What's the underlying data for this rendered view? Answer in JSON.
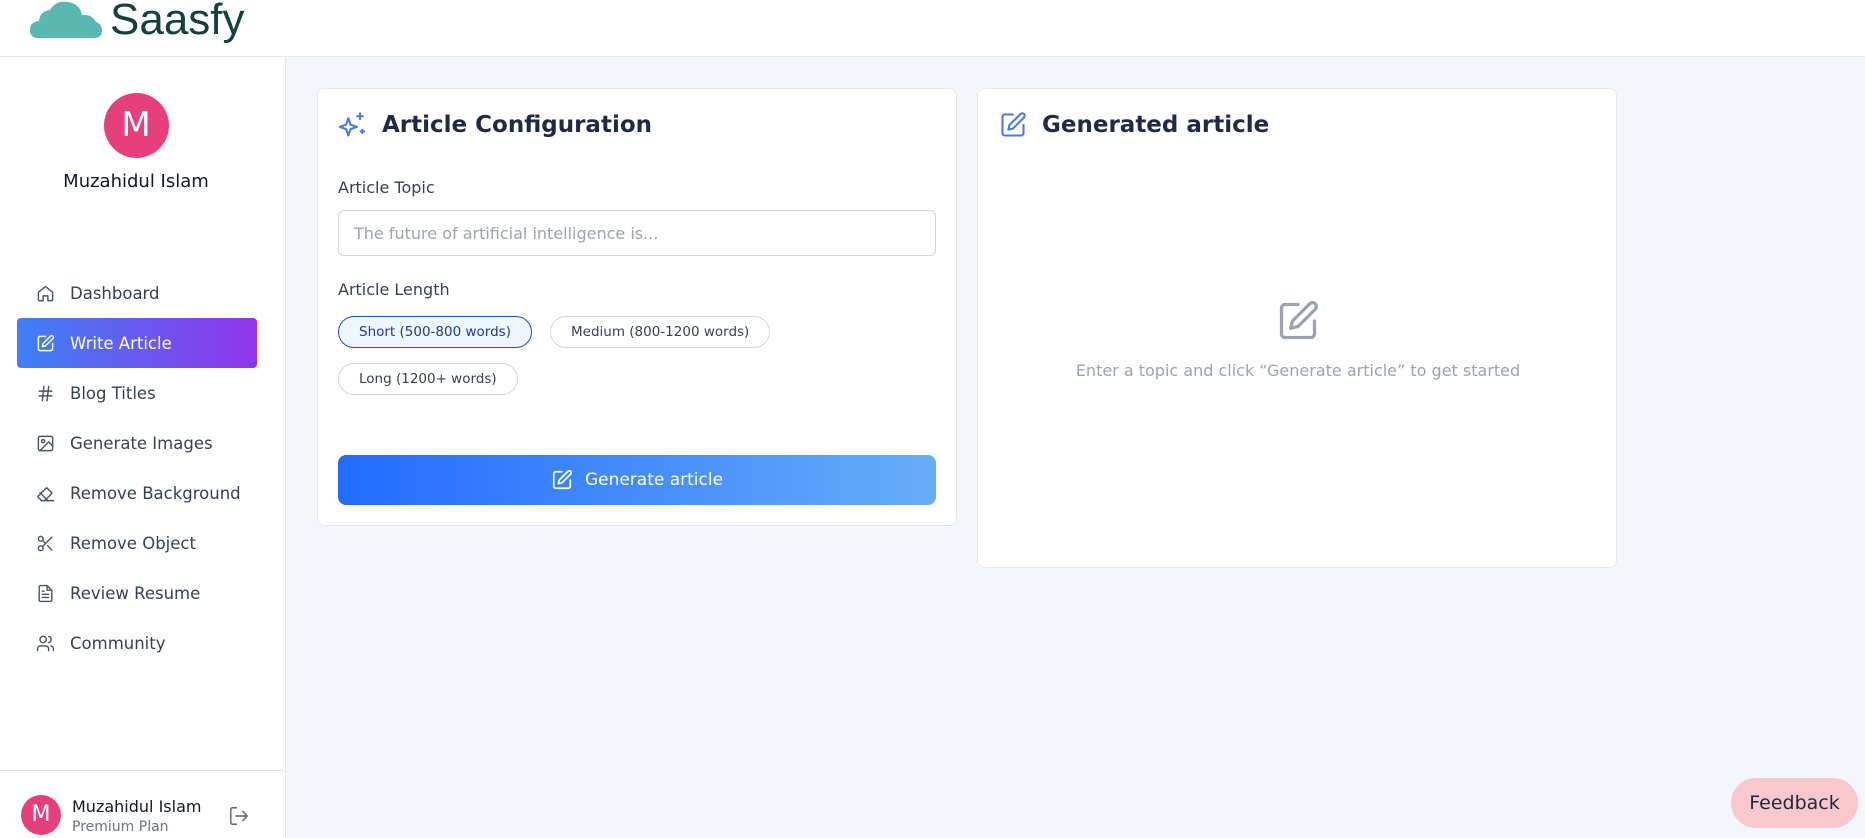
{
  "app": {
    "name": "Saasfy",
    "brand_color": "#4fb3ad"
  },
  "user": {
    "initial": "M",
    "name": "Muzahidul Islam",
    "plan": "Premium Plan",
    "avatar_color": "#e73e7c"
  },
  "sidebar": {
    "items": [
      {
        "label": "Dashboard",
        "icon": "home-icon",
        "active": false
      },
      {
        "label": "Write Article",
        "icon": "edit-icon",
        "active": true
      },
      {
        "label": "Blog Titles",
        "icon": "hash-icon",
        "active": false
      },
      {
        "label": "Generate Images",
        "icon": "image-icon",
        "active": false
      },
      {
        "label": "Remove Background",
        "icon": "eraser-icon",
        "active": false
      },
      {
        "label": "Remove Object",
        "icon": "scissors-icon",
        "active": false
      },
      {
        "label": "Review Resume",
        "icon": "file-text-icon",
        "active": false
      },
      {
        "label": "Community",
        "icon": "users-icon",
        "active": false
      }
    ],
    "active_gradient": [
      "#3c81f6",
      "#9234ea"
    ]
  },
  "config": {
    "title": "Article Configuration",
    "topic_label": "Article Topic",
    "topic_placeholder": "The future of artificial intelligence is...",
    "topic_value": "",
    "length_label": "Article Length",
    "length_options": [
      {
        "label": "Short (500-800 words)",
        "selected": true
      },
      {
        "label": "Medium (800-1200 words)",
        "selected": false
      },
      {
        "label": "Long (1200+ words)",
        "selected": false
      }
    ],
    "button_label": "Generate article"
  },
  "result": {
    "title": "Generated article",
    "empty_text": "Enter a topic and click “Generate article” to get started"
  },
  "feedback_label": "Feedback"
}
